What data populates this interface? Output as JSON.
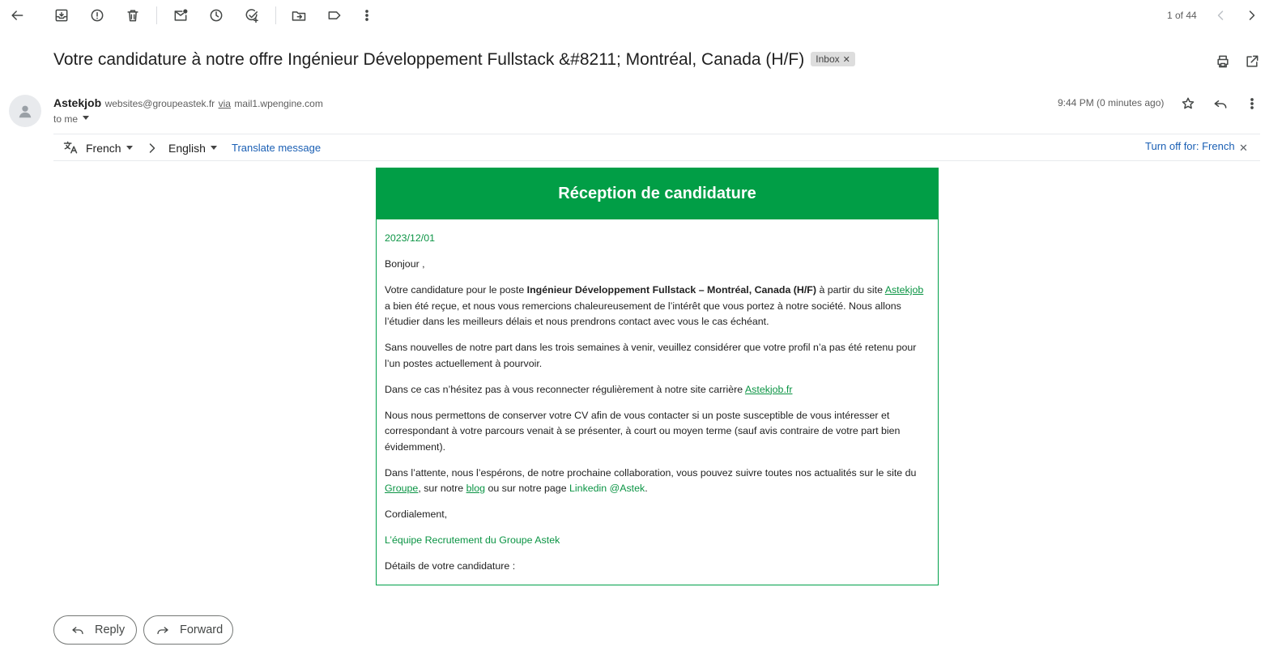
{
  "toolbar": {
    "pagination": "1 of 44"
  },
  "subject": "Votre candidature à notre offre Ingénieur Développement Fullstack &#8211; Montréal, Canada (H/F)",
  "label": "Inbox",
  "sender": {
    "name": "Astekjob",
    "email": "websites@groupeastek.fr",
    "via": "via",
    "via_domain": "mail1.wpengine.com",
    "to": "to me",
    "time": "9:44 PM (0 minutes ago)"
  },
  "translate": {
    "from_lang": "French",
    "to_lang": "English",
    "translate_link": "Translate message",
    "turn_off": "Turn off for: French"
  },
  "email": {
    "header": "Réception de candidature",
    "date": "2023/12/01",
    "greeting": "Bonjour ,",
    "p1_a": "Votre candidature pour le poste ",
    "p1_bold": "Ingénieur Développement Fullstack – Montréal, Canada (H/F)",
    "p1_b": " à partir du site ",
    "p1_link": "Astekjob",
    "p1_c": " a bien été reçue, et nous vous remercions chaleureusement de l’intérêt que vous portez à notre société. Nous allons l’étudier dans les meilleurs délais et nous prendrons contact avec vous le cas échéant.",
    "p2": "Sans nouvelles de notre part dans les trois semaines à venir, veuillez considérer que votre profil n’a pas été retenu pour l’un postes actuellement à pourvoir.",
    "p3_a": "Dans ce cas n’hésitez pas à vous reconnecter régulièrement à notre site carrière ",
    "p3_link": "Astekjob.fr",
    "p4": "Nous nous permettons de conserver votre CV afin de vous contacter si un poste susceptible de vous intéresser et correspondant à votre parcours venait à se présenter, à court ou moyen terme (sauf avis contraire de votre part bien évidemment).",
    "p5_a": "Dans l’attente, nous l’espérons, de notre prochaine collaboration, vous pouvez suivre toutes nos actualités sur le site du ",
    "p5_link1": "Groupe",
    "p5_b": ", sur notre ",
    "p5_link2": "blog",
    "p5_c": " ou sur notre page ",
    "p5_link3": "Linkedin @Astek",
    "p5_d": ".",
    "closing": "Cordialement,",
    "signature": "L’équipe Recrutement du Groupe Astek",
    "details": "Détails de votre candidature :"
  },
  "actions": {
    "reply": "Reply",
    "forward": "Forward"
  },
  "colors": {
    "brand_green": "#019e46",
    "link_blue": "#1a5fb4"
  }
}
